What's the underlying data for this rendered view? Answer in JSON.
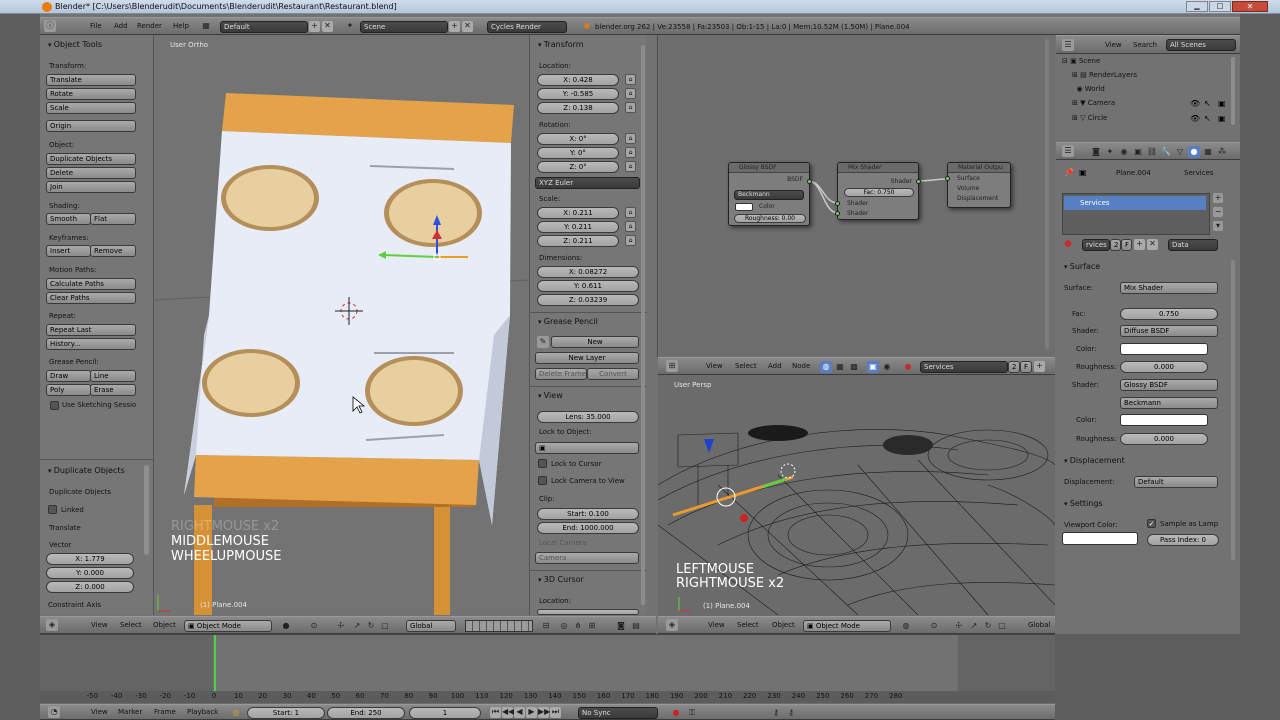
{
  "top": {
    "title": "Blender* [C:\\Users\\Blenderudit\\Documents\\Blenderudit\\Restaurant\\Restaurant.blend]",
    "menus": [
      "File",
      "Add",
      "Render",
      "Help"
    ],
    "layout": "Default",
    "scene": "Scene",
    "engine": "Cycles Render",
    "stats": "blender.org 262 | Ve:23558 | Fa:23503 | Ob:1-15 | La:0 | Mem:10.52M (1.50M) | Plane.004"
  },
  "tools": {
    "title": "Object Tools",
    "transform_label": "Transform:",
    "translate": "Translate",
    "rotate": "Rotate",
    "scale": "Scale",
    "origin": "Origin",
    "object_label": "Object:",
    "duplicate_objects": "Duplicate Objects",
    "delete": "Delete",
    "join": "Join",
    "shading_label": "Shading:",
    "smooth": "Smooth",
    "flat": "Flat",
    "keyframes_label": "Keyframes:",
    "insert": "Insert",
    "remove": "Remove",
    "motion_label": "Motion Paths:",
    "calculate_paths": "Calculate Paths",
    "clear_paths": "Clear Paths",
    "repeat_label": "Repeat:",
    "repeat_last": "Repeat Last",
    "history": "History...",
    "grease_label": "Grease Pencil:",
    "draw": "Draw",
    "line": "Line",
    "poly": "Poly",
    "erase": "Erase",
    "sketching": "Use Sketching Sessio"
  },
  "dup": {
    "title": "Duplicate Objects",
    "heading": "Duplicate Objects",
    "linked": "Linked",
    "translate": "Translate",
    "vector_label": "Vector",
    "x": "X: 1.779",
    "y": "Y: 0.000",
    "z": "Z: 0.000",
    "constraint": "Constraint Axis"
  },
  "viewport": {
    "name": "User Ortho",
    "key_ghost": "RIGHTMOUSE x2",
    "key1": "MIDDLEMOUSE",
    "key2": "WHEELUPMOUSE",
    "obj": "(1) Plane.004"
  },
  "props": {
    "transform": "Transform",
    "location_label": "Location:",
    "lx": "X: 0.428",
    "ly": "Y: -0.585",
    "lz": "Z: 0.138",
    "rotation_label": "Rotation:",
    "rx": "X: 0°",
    "ry": "Y: 0°",
    "rz": "Z: 0°",
    "euler": "XYZ Euler",
    "scale_label": "Scale:",
    "sx": "X: 0.211",
    "sy": "Y: 0.211",
    "sz": "Z: 0.211",
    "dim_label": "Dimensions:",
    "dx": "X: 0.08272",
    "dy": "Y: 0.611",
    "dz": "Z: 0.03239",
    "grease": "Grease Pencil",
    "gp_new": "New",
    "gp_new_layer": "New Layer",
    "gp_delete": "Delete Frame",
    "gp_convert": "Convert",
    "view": "View",
    "lens": "Lens: 35.000",
    "lock_obj": "Lock to Object:",
    "lock_cursor": "Lock to Cursor",
    "lock_camera": "Lock Camera to View",
    "clip_label": "Clip:",
    "clip_start": "Start: 0.100",
    "clip_end": "End: 1000.000",
    "local_camera": "Local Camera",
    "camera": "Camera",
    "cursor3d": "3D Cursor",
    "cursor_loc": "Location:"
  },
  "bottom_left": {
    "menus": [
      "View",
      "Select",
      "Object"
    ],
    "mode": "Object Mode",
    "orient": "Global"
  },
  "node_editor": {
    "glossy": {
      "title": "Glossy BSDF",
      "out": "BSDF",
      "dist": "Beckmann",
      "color": "Color",
      "rough": "Roughness: 0.00"
    },
    "mix": {
      "title": "Mix Shader",
      "out": "Shader",
      "fac": "Fac: 0.750",
      "in1": "Shader",
      "in2": "Shader"
    },
    "output": {
      "title": "Material Outpu",
      "surface": "Surface",
      "volume": "Volume",
      "disp": "Displacement"
    },
    "menus": [
      "View",
      "Select",
      "Add",
      "Node"
    ],
    "material": "Services",
    "users": "2",
    "f": "F"
  },
  "viewport2": {
    "name": "User Persp",
    "key1": "LEFTMOUSE",
    "key2": "RIGHTMOUSE x2",
    "obj": "(1) Plane.004",
    "menus": [
      "View",
      "Select",
      "Object"
    ],
    "mode": "Object Mode",
    "orient": "Global"
  },
  "outliner": {
    "menus": [
      "View",
      "Search"
    ],
    "filter": "All Scenes",
    "items": [
      "Scene",
      "RenderLayers",
      "World",
      "Camera",
      "Circle"
    ]
  },
  "material_panel": {
    "crumb_obj": "Plane.004",
    "crumb_mat": "Services",
    "slot": "Services",
    "matname": "rvices",
    "users": "2",
    "f": "F",
    "data": "Data",
    "surface_sec": "Surface",
    "surface_label": "Surface:",
    "surface_val": "Mix Shader",
    "fac_label": "Fac:",
    "fac_val": "0.750",
    "shader1_label": "Shader:",
    "shader1_val": "Diffuse BSDF",
    "color1_label": "Color:",
    "rough1_label": "Roughness:",
    "rough1_val": "0.000",
    "shader2_label": "Shader:",
    "shader2_val": "Glossy BSDF",
    "dist2": "Beckmann",
    "color2_label": "Color:",
    "rough2_label": "Roughness:",
    "rough2_val": "0.000",
    "disp_sec": "Displacement",
    "disp_label": "Displacement:",
    "disp_val": "Default",
    "settings_sec": "Settings",
    "vpcolor_label": "Viewport Color:",
    "sample_lamp": "Sample as Lamp",
    "pass_index": "Pass Index: 0"
  },
  "timeline": {
    "ticks": [
      "-50",
      "-40",
      "-30",
      "-20",
      "-10",
      "0",
      "10",
      "20",
      "30",
      "40",
      "50",
      "60",
      "70",
      "80",
      "90",
      "100",
      "110",
      "120",
      "130",
      "140",
      "150",
      "160",
      "170",
      "180",
      "190",
      "200",
      "210",
      "220",
      "230",
      "240",
      "250",
      "260",
      "270",
      "280"
    ],
    "menus": [
      "View",
      "Marker",
      "Frame",
      "Playback"
    ],
    "start": "Start: 1",
    "end": "End: 250",
    "current": "1",
    "sync": "No Sync",
    "current_frame": 1
  }
}
